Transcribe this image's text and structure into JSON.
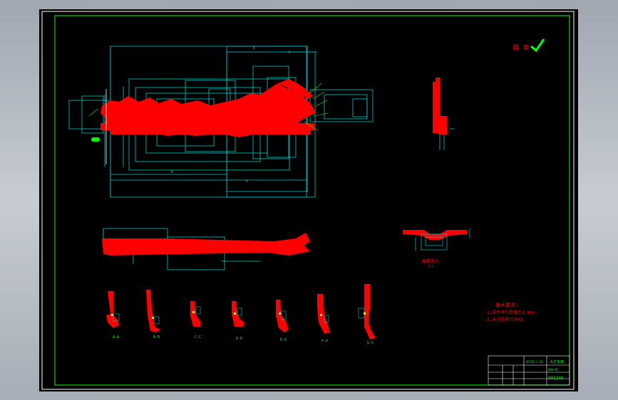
{
  "drawing": {
    "mark": "简 单",
    "section_label_main": "截面放大",
    "section_scale": "2:1",
    "section_labels": [
      "A-A",
      "B-B",
      "C-C",
      "D-D",
      "E-E",
      "F-F",
      "G-G"
    ],
    "notes_title": "技术要求:",
    "notes": [
      "1.零件平均厚度为1.8mm;",
      "2.未注圆角均为R2."
    ]
  },
  "title_block": {
    "name": "大灯支架",
    "material": "ABS+PC",
    "code": "092340",
    "scale_code": "XF252-1-01"
  },
  "colors": {
    "background": "#000000",
    "frame": "#ffffff",
    "geometry": "#ff0000",
    "dimension": "#00ffff",
    "text": "#00ff00",
    "annotation": "#ff00ff"
  }
}
